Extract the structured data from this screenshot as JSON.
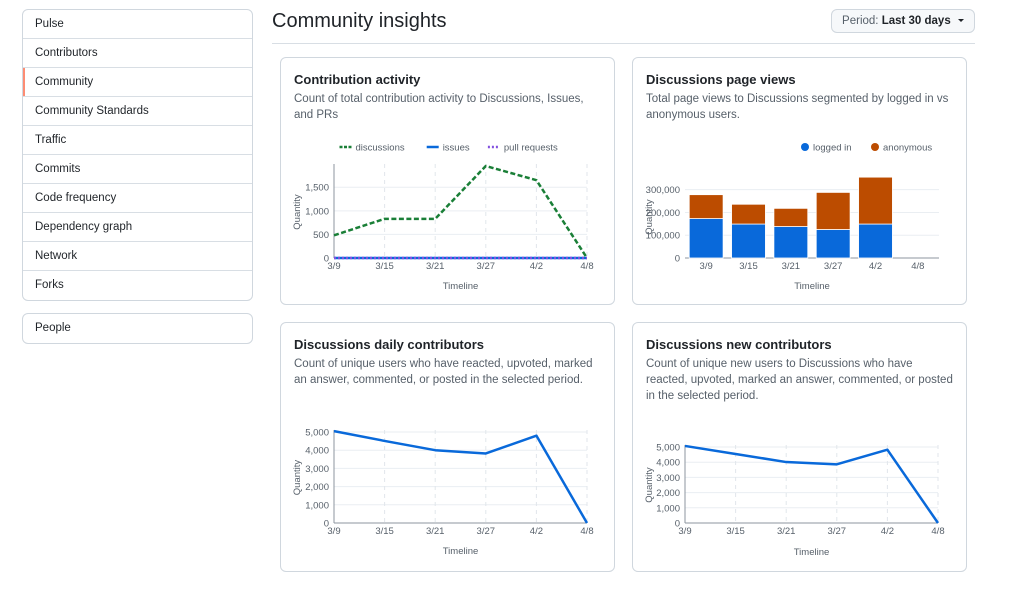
{
  "sidebar": {
    "items": [
      {
        "label": "Pulse",
        "selected": false
      },
      {
        "label": "Contributors",
        "selected": false
      },
      {
        "label": "Community",
        "selected": true
      },
      {
        "label": "Community Standards",
        "selected": false
      },
      {
        "label": "Traffic",
        "selected": false
      },
      {
        "label": "Commits",
        "selected": false
      },
      {
        "label": "Code frequency",
        "selected": false
      },
      {
        "label": "Dependency graph",
        "selected": false
      },
      {
        "label": "Network",
        "selected": false
      },
      {
        "label": "Forks",
        "selected": false
      }
    ],
    "secondary": [
      {
        "label": "People"
      }
    ],
    "selected_accent": "#fd8c73"
  },
  "header": {
    "title": "Community insights",
    "period": {
      "label": "Period:",
      "value": "Last 30 days",
      "icon": "caret-down-icon"
    }
  },
  "cards": [
    {
      "title": "Contribution activity",
      "description": "Count of total contribution activity to Discussions, Issues, and PRs"
    },
    {
      "title": "Discussions page views",
      "description": "Total page views to Discussions segmented by logged in vs anonymous users."
    },
    {
      "title": "Discussions daily contributors",
      "description": "Count of unique users who have reacted, upvoted, marked an answer, commented, or posted in the selected period."
    },
    {
      "title": "Discussions new contributors",
      "description": "Count of unique new users to Discussions who have reacted, upvoted, marked an answer, commented, or posted in the selected period."
    }
  ],
  "chart_data": [
    {
      "type": "line",
      "title": "Contribution activity",
      "x": [
        "3/9",
        "3/15",
        "3/21",
        "3/27",
        "4/2",
        "4/8"
      ],
      "xlabel": "Timeline",
      "ylabel": "Quantity",
      "yticks": [
        0,
        500,
        1000,
        1500
      ],
      "ytick_labels": [
        "0",
        "500",
        "1,000",
        "1,500"
      ],
      "ylim": [
        0,
        1950
      ],
      "grid": true,
      "legend": "top-center",
      "series": [
        {
          "name": "discussions",
          "color": "#1a7f37",
          "style": "dashed",
          "values": [
            480,
            830,
            830,
            1950,
            1650,
            0
          ]
        },
        {
          "name": "issues",
          "color": "#0969da",
          "style": "solid",
          "values": [
            0,
            0,
            0,
            0,
            0,
            0
          ]
        },
        {
          "name": "pull requests",
          "color": "#8250df",
          "style": "dotted",
          "values": [
            0,
            0,
            0,
            0,
            0,
            0
          ]
        }
      ]
    },
    {
      "type": "bar",
      "stacked": true,
      "title": "Discussions page views",
      "categories": [
        "3/9",
        "3/15",
        "3/21",
        "3/27",
        "4/2",
        "4/8"
      ],
      "xlabel": "Timeline",
      "ylabel": "Quantity",
      "yticks": [
        0,
        100000,
        200000,
        300000
      ],
      "ytick_labels": [
        "0",
        "100,000",
        "200,000",
        "300,000"
      ],
      "ylim": [
        0,
        360000
      ],
      "grid": true,
      "legend": "top-right",
      "series": [
        {
          "name": "logged in",
          "color": "#0969da",
          "values": [
            173000,
            149000,
            138000,
            125000,
            149000,
            0
          ]
        },
        {
          "name": "anonymous",
          "color": "#bc4c00",
          "values": [
            105000,
            87000,
            80000,
            163000,
            206000,
            0
          ]
        }
      ]
    },
    {
      "type": "line",
      "title": "Discussions daily contributors",
      "x": [
        "3/9",
        "3/15",
        "3/21",
        "3/27",
        "4/2",
        "4/8"
      ],
      "xlabel": "Timeline",
      "ylabel": "Quantity",
      "yticks": [
        0,
        1000,
        2000,
        3000,
        4000,
        5000
      ],
      "ytick_labels": [
        "0",
        "1,000",
        "2,000",
        "3,000",
        "4,000",
        "5,000"
      ],
      "ylim": [
        0,
        5000
      ],
      "grid": true,
      "series": [
        {
          "name": "contributors",
          "color": "#0969da",
          "style": "solid",
          "values": [
            5050,
            4510,
            4000,
            3820,
            4800,
            0
          ]
        }
      ]
    },
    {
      "type": "line",
      "title": "Discussions new contributors",
      "x": [
        "3/9",
        "3/15",
        "3/21",
        "3/27",
        "4/2",
        "4/8"
      ],
      "xlabel": "Timeline",
      "ylabel": "Quantity",
      "yticks": [
        0,
        1000,
        2000,
        3000,
        4000,
        5000
      ],
      "ytick_labels": [
        "0",
        "1,000",
        "2,000",
        "3,000",
        "4,000",
        "5,000"
      ],
      "ylim": [
        0,
        5000
      ],
      "grid": true,
      "series": [
        {
          "name": "new contributors",
          "color": "#0969da",
          "style": "solid",
          "values": [
            5070,
            4540,
            4010,
            3860,
            4820,
            0
          ]
        }
      ]
    }
  ]
}
